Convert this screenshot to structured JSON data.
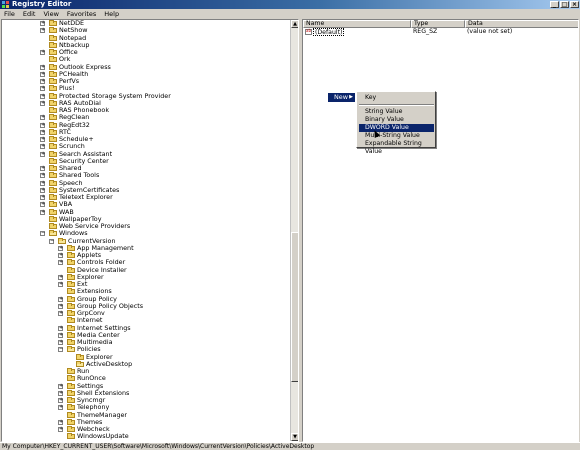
{
  "window": {
    "title": "Registry Editor"
  },
  "menubar": [
    "File",
    "Edit",
    "View",
    "Favorites",
    "Help"
  ],
  "tree_items": [
    {
      "label": "NetDDE",
      "expandable": true
    },
    {
      "label": "NetShow",
      "expandable": true
    },
    {
      "label": "Notepad",
      "expandable": false
    },
    {
      "label": "Ntbackup",
      "expandable": false
    },
    {
      "label": "Office",
      "expandable": true
    },
    {
      "label": "Ork",
      "expandable": false
    },
    {
      "label": "Outlook Express",
      "expandable": true
    },
    {
      "label": "PCHealth",
      "expandable": true
    },
    {
      "label": "PerfVs",
      "expandable": true
    },
    {
      "label": "Plus!",
      "expandable": true
    },
    {
      "label": "Protected Storage System Provider",
      "expandable": true
    },
    {
      "label": "RAS AutoDial",
      "expandable": true
    },
    {
      "label": "RAS Phonebook",
      "expandable": false
    },
    {
      "label": "RegClean",
      "expandable": true
    },
    {
      "label": "RegEdt32",
      "expandable": true
    },
    {
      "label": "RTC",
      "expandable": true
    },
    {
      "label": "Schedule+",
      "expandable": true
    },
    {
      "label": "Scrunch",
      "expandable": true
    },
    {
      "label": "Search Assistant",
      "expandable": true
    },
    {
      "label": "Security Center",
      "expandable": false
    },
    {
      "label": "Shared",
      "expandable": true
    },
    {
      "label": "Shared Tools",
      "expandable": true
    },
    {
      "label": "Speech",
      "expandable": true
    },
    {
      "label": "SystemCertificates",
      "expandable": true
    },
    {
      "label": "Teletext Explorer",
      "expandable": true
    },
    {
      "label": "VBA",
      "expandable": true
    },
    {
      "label": "WAB",
      "expandable": true
    },
    {
      "label": "WallpaperToy",
      "expandable": false
    },
    {
      "label": "Web Service Providers",
      "expandable": false
    },
    {
      "label": "Windows",
      "expandable": true,
      "expanded": true
    },
    {
      "label": "CurrentVersion",
      "expandable": true,
      "expanded": true
    },
    {
      "label": "App Management",
      "expandable": true
    },
    {
      "label": "Applets",
      "expandable": true
    },
    {
      "label": "Controls Folder",
      "expandable": true
    },
    {
      "label": "Device Installer",
      "expandable": false
    },
    {
      "label": "Explorer",
      "expandable": true
    },
    {
      "label": "Ext",
      "expandable": true
    },
    {
      "label": "Extensions",
      "expandable": false
    },
    {
      "label": "Group Policy",
      "expandable": true
    },
    {
      "label": "Group Policy Objects",
      "expandable": true
    },
    {
      "label": "GrpConv",
      "expandable": true
    },
    {
      "label": "Internet",
      "expandable": false
    },
    {
      "label": "Internet Settings",
      "expandable": true
    },
    {
      "label": "Media Center",
      "expandable": true
    },
    {
      "label": "Multimedia",
      "expandable": true
    },
    {
      "label": "Policies",
      "expandable": true,
      "expanded": true
    },
    {
      "label": "Explorer",
      "expandable": false
    },
    {
      "label": "ActiveDesktop",
      "expandable": false,
      "selected": true
    },
    {
      "label": "Run",
      "expandable": false
    },
    {
      "label": "RunOnce",
      "expandable": false
    },
    {
      "label": "Settings",
      "expandable": true
    },
    {
      "label": "Shell Extensions",
      "expandable": true
    },
    {
      "label": "Syncmgr",
      "expandable": true
    },
    {
      "label": "Telephony",
      "expandable": true
    },
    {
      "label": "ThemeManager",
      "expandable": false
    },
    {
      "label": "Themes",
      "expandable": true
    },
    {
      "label": "Webcheck",
      "expandable": true
    },
    {
      "label": "WindowsUpdate",
      "expandable": false
    }
  ],
  "columns": {
    "name": "Name",
    "type": "Type",
    "data": "Data"
  },
  "values": [
    {
      "name": "(Default)",
      "type": "REG_SZ",
      "data": "(value not set)"
    }
  ],
  "context_menu": {
    "new_label": "New",
    "submenu": [
      {
        "label": "Key"
      },
      {
        "separator": true
      },
      {
        "label": "String Value"
      },
      {
        "label": "Binary Value"
      },
      {
        "label": "DWORD Value",
        "highlighted": true
      },
      {
        "label": "Multi-String Value"
      },
      {
        "label": "Expandable String Value"
      }
    ]
  },
  "statusbar": {
    "path": "My Computer\\HKEY_CURRENT_USER\\Software\\Microsoft\\Windows\\CurrentVersion\\Policies\\ActiveDesktop"
  },
  "colors": {
    "title_start": "#0a246a",
    "highlight": "#0a246a",
    "face": "#d4d0c8",
    "folder": "#f1d46a"
  }
}
